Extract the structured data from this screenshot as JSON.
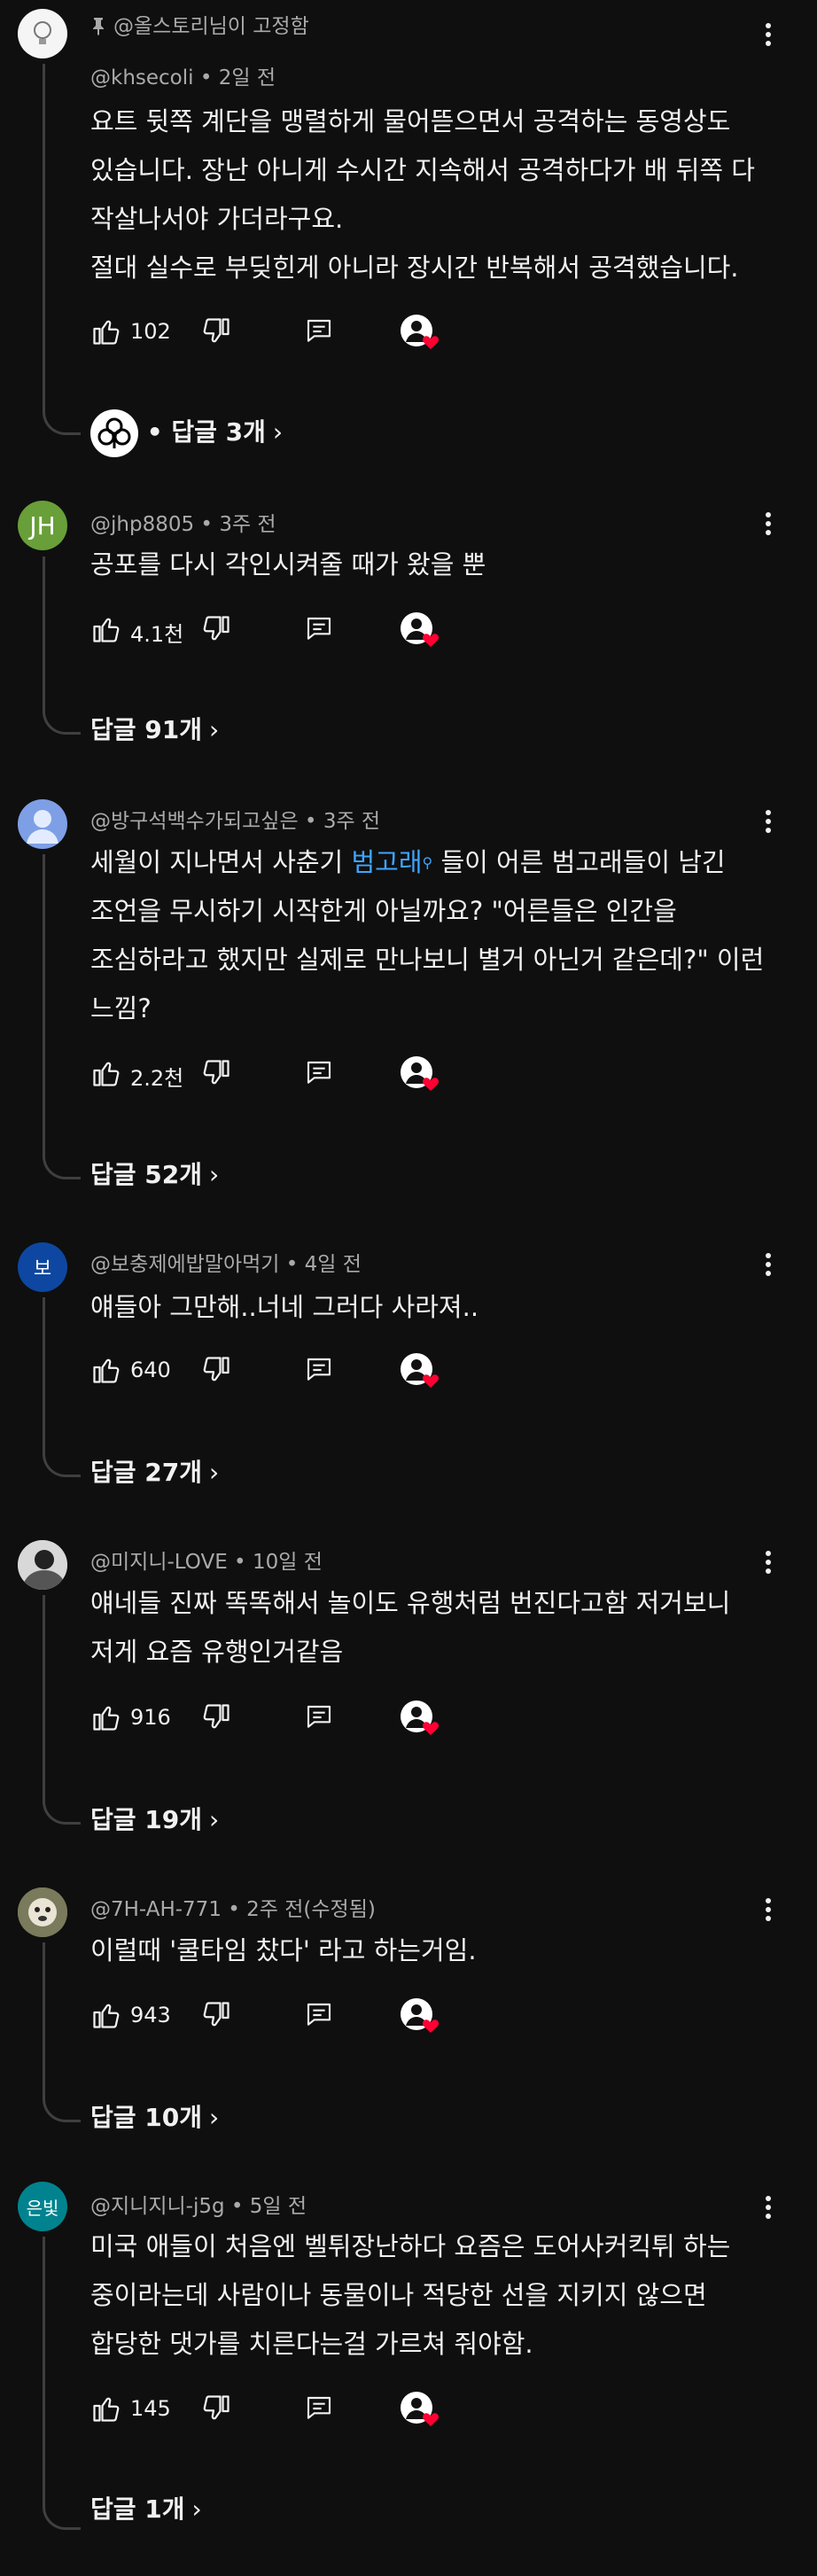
{
  "comments": [
    {
      "pinned_text": "@올스토리님이 고정함",
      "handle": "@khsecoli",
      "time": "2일 전",
      "lines": [
        "요트 뒷쪽 계단을 맹렬하게 물어뜯으면서 공격하는 동영상도",
        "있습니다. 장난 아니게 수시간 지속해서 공격하다가 배 뒤쪽 다",
        "작살나서야 가더라구요.",
        "절대 실수로 부딪힌게 아니라 장시간 반복해서 공격했습니다."
      ],
      "likes": "102",
      "replies": "• 답글 3개",
      "avatar_icon": "bulb-avatar-icon"
    },
    {
      "handle": "@jhp8805",
      "time": "3주 전",
      "lines": [
        "공포를 다시 각인시켜줄 때가 왔을 뿐"
      ],
      "likes": "4.1천",
      "replies": "답글 91개",
      "avatar_text": "JH",
      "avatar_color": "#689f38"
    },
    {
      "handle": "@방구석백수가되고싶은",
      "time": "3주 전",
      "line1_pre": "세월이 지나면서 사춘기 ",
      "line1_link": "범고래",
      "line1_post": " 들이 어른 범고래들이 남긴",
      "lines_rest": [
        "조언을 무시하기 시작한게 아닐까요? \"어른들은 인간을",
        "조심하라고 했지만 실제로 만나보니 별거 아닌거 같은데?\" 이런",
        "느낌?"
      ],
      "likes": "2.2천",
      "replies": "답글 52개",
      "avatar_icon": "default-user-avatar-icon"
    },
    {
      "handle": "@보충제에밥말아먹기",
      "time": "4일 전",
      "lines": [
        "얘들아 그만해..너네 그러다 사라져.."
      ],
      "likes": "640",
      "replies": "답글 27개",
      "avatar_text": "보",
      "avatar_color": "#0d47a1"
    },
    {
      "handle": "@미지니-LOVE",
      "time": "10일 전",
      "lines": [
        "얘네들 진짜 똑똑해서 놀이도 유행처럼 번진다고함 저거보니",
        "저게 요즘 유행인거같음"
      ],
      "likes": "916",
      "replies": "답글 19개",
      "avatar_icon": "photo-avatar-icon"
    },
    {
      "handle": "@7H-AH-771",
      "time": "2주 전(수정됨)",
      "lines": [
        "이럴때 '쿨타임 찼다' 라고 하는거임."
      ],
      "likes": "943",
      "replies": "답글 10개",
      "avatar_icon": "photo-avatar-icon"
    },
    {
      "handle": "@지니지니-j5g",
      "time": "5일 전",
      "lines": [
        "미국 애들이 처음엔 벨튀장난하다 요즘은 도어사커킥튀 하는",
        "중이라는데 사람이나 동물이나 적당한 선을 지키지 않으면",
        "합당한 댓가를 치른다는걸 가르쳐 줘야함."
      ],
      "likes": "145",
      "replies": "답글 1개",
      "avatar_text": "은빛",
      "avatar_color": "#00838f"
    }
  ],
  "chevron": "›",
  "colors": {
    "background": "#0f0f0f",
    "text": "#f1f1f1",
    "secondary": "#aaaaaa",
    "link": "#3ea6ff",
    "heart": "#ff0033"
  }
}
